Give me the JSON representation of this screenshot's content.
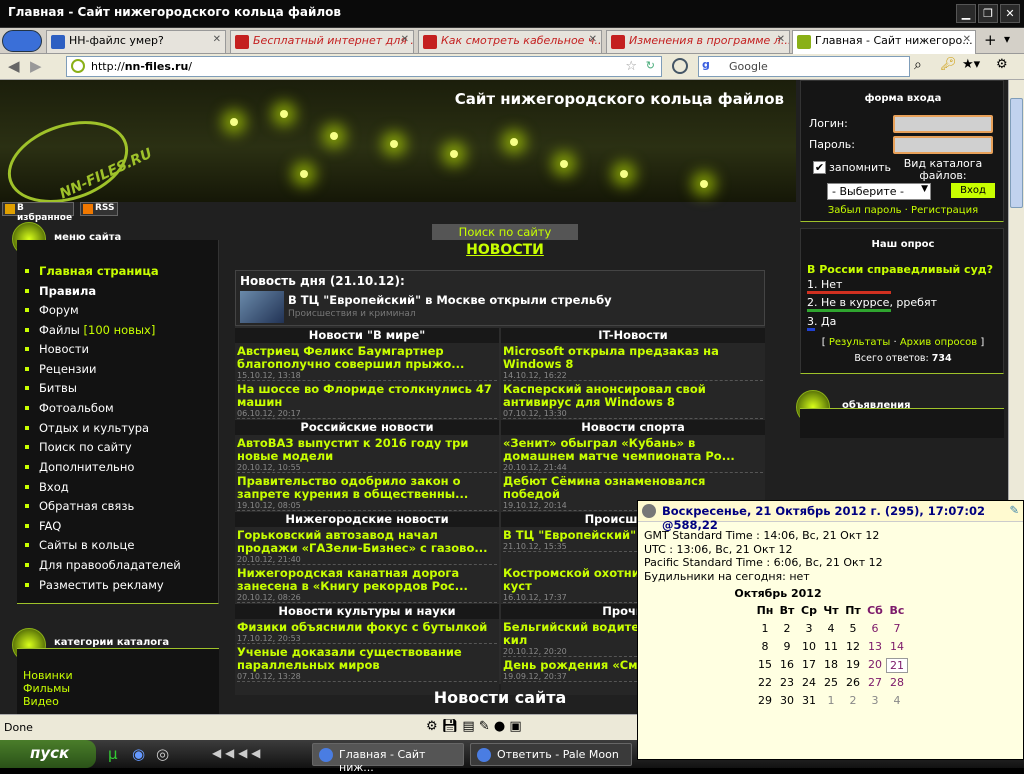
{
  "window": {
    "title": "Главная - Сайт нижегородского кольца файлов"
  },
  "tabs": [
    {
      "label": "НН-файлс умер?",
      "color": "#2d5fc2"
    },
    {
      "label": "Бесплатный интернет для ...",
      "color": "#c42020"
    },
    {
      "label": "Как смотреть кабельное ч...",
      "color": "#c42020"
    },
    {
      "label": "Изменения в программе л...",
      "color": "#c42020"
    },
    {
      "label": "Главная - Сайт нижегоро...",
      "color": "#8ab017"
    }
  ],
  "nav": {
    "url_prefix": "http://",
    "url_host": "nn-files.ru",
    "url_suffix": "/",
    "search_engine": "Google"
  },
  "site": {
    "title": "Сайт нижегородского кольца файлов",
    "logo": "NN-FILES.RU",
    "fav_label": "В избранное",
    "rss_label": "RSS"
  },
  "menu": {
    "heading": "меню сайта",
    "items": [
      "Главная страница",
      "Правила",
      "Форум",
      "Файлы",
      "Новости",
      "Рецензии",
      "Битвы",
      "Фотоальбом",
      "Отдых и культура",
      "Поиск по сайту",
      "Дополнительно",
      "Вход",
      "Обратная связь",
      "FAQ",
      "Сайты в кольце",
      "Для правообладателей",
      "Разместить рекламу"
    ],
    "files_badge": "[100 новых]"
  },
  "catalog": {
    "heading": "категории каталога",
    "items": [
      "Новинки",
      "Фильмы",
      "Видео"
    ]
  },
  "center": {
    "search_link": "Поиск по сайту",
    "news_heading": "НОВОСТИ",
    "news_of_day": {
      "heading": "Новость дня (21.10.12):",
      "title": "В ТЦ \"Европейский\" в Москве открыли стрельбу",
      "category": "Происшествия и криминал"
    },
    "columns": [
      {
        "heading": "Новости \"В мире\"",
        "items": [
          {
            "title": "Австриец Феликс Баумгартнер благополучно совершил прыжо...",
            "date": "15.10.12, 13:18"
          },
          {
            "title": "На шоссе во Флориде столкнулись 47 машин",
            "date": "06.10.12, 20:17"
          }
        ]
      },
      {
        "heading": "IT-Новости",
        "items": [
          {
            "title": "Microsoft открыла предзаказ на Windows 8",
            "date": "14.10.12, 16:22"
          },
          {
            "title": "Касперский анонсировал свой антивирус для Windows 8",
            "date": "07.10.12, 13:30"
          }
        ]
      },
      {
        "heading": "Российские новости",
        "items": [
          {
            "title": "АвтоВАЗ выпустит к 2016 году три новые модели",
            "date": "20.10.12, 10:55"
          },
          {
            "title": "Правительство одобрило закон о запрете курения в общественны...",
            "date": "19.10.12, 08:05"
          }
        ]
      },
      {
        "heading": "Новости спорта",
        "items": [
          {
            "title": "«Зенит» обыграл «Кубань» в домашнем матче чемпионата Ро...",
            "date": "20.10.12, 21:44"
          },
          {
            "title": "Дебют Сёмина ознаменовался победой",
            "date": "19.10.12, 20:14"
          }
        ]
      },
      {
        "heading": "Нижегородские новости",
        "items": [
          {
            "title": "Горьковский автозавод начал продажи «ГАЗели-Бизнес» с газово...",
            "date": "20.10.12, 21:40"
          },
          {
            "title": "Нижегородская канатная дорога занесена в «Книгу рекордов Рос...",
            "date": "20.10.12, 08:26"
          }
        ]
      },
      {
        "heading": "Происшествия",
        "items": [
          {
            "title": "В ТЦ \"Европейский\" стрельбу",
            "date": "21.10.12, 15:35"
          },
          {
            "title": "Костромской охотни хрюкнувшего в куст",
            "date": "16.10.12, 17:37"
          }
        ]
      },
      {
        "heading": "Новости культуры и науки",
        "items": [
          {
            "title": "Физики объяснили фокус с бутылкой",
            "date": "17.10.12, 20:53"
          },
          {
            "title": "Ученые доказали существование параллельных миров",
            "date": "07.10.12, 13:28"
          }
        ]
      },
      {
        "heading": "Прочие н",
        "items": [
          {
            "title": "Бельгийский водител скорость на 173 кил",
            "date": "20.10.12, 20:20"
          },
          {
            "title": "День рождения «См",
            "date": "19.09.12, 20:37"
          }
        ]
      }
    ],
    "site_news": "Новости сайта"
  },
  "login": {
    "heading": "форма входа",
    "login_label": "Логин:",
    "password_label": "Пароль:",
    "remember_label": "запомнить",
    "catalog_view_label": "Вид каталога файлов:",
    "select_value": "- Выберите -",
    "submit_label": "Вход",
    "forgot_link": "Забыл пароль",
    "register_link": "Регистрация",
    "separator": "·"
  },
  "poll": {
    "heading": "Наш опрос",
    "question": "В России справедливый суд?",
    "options": [
      {
        "label": "1. Нет",
        "bar_color": "#d03020",
        "share": 0.42
      },
      {
        "label": "2. Не в куррсе, рребят",
        "bar_color": "#2fa52f",
        "share": 0.42
      },
      {
        "label": "3. Да",
        "bar_color": "#2040d0",
        "share": 0.04
      }
    ],
    "results_link": "Результаты",
    "archive_link": "Архив опросов",
    "bracket_left": "[",
    "bracket_right": "]",
    "links_separator": "·",
    "total_label": "Всего ответов:",
    "total_value": "734"
  },
  "ads": {
    "heading": "объявления"
  },
  "status": {
    "text": "Done"
  },
  "taskbar": {
    "start": "пуск",
    "tasks": [
      "Главная - Сайт ниж...",
      "Ответить - Pale Moon"
    ]
  },
  "clock": {
    "header": "Воскресенье, 21 Октябрь 2012 г. (295), 17:07:02 @588,22",
    "lines": [
      "GMT Standard Time : 14:06, Вс, 21 Окт 12",
      "UTC : 13:06, Вс, 21 Окт 12",
      "Pacific Standard Time : 6:06, Вс, 21 Окт 12",
      "Будильники на сегодня: нет"
    ],
    "month": "Октябрь 2012",
    "weekdays": [
      "Пн",
      "Вт",
      "Ср",
      "Чт",
      "Пт",
      "Сб",
      "Вс"
    ],
    "weeks": [
      [
        "1",
        "2",
        "3",
        "4",
        "5",
        "6",
        "7"
      ],
      [
        "8",
        "9",
        "10",
        "11",
        "12",
        "13",
        "14"
      ],
      [
        "15",
        "16",
        "17",
        "18",
        "19",
        "20",
        "21"
      ],
      [
        "22",
        "23",
        "24",
        "25",
        "26",
        "27",
        "28"
      ],
      [
        "29",
        "30",
        "31",
        "1",
        "2",
        "3",
        "4"
      ]
    ],
    "today": "21"
  }
}
